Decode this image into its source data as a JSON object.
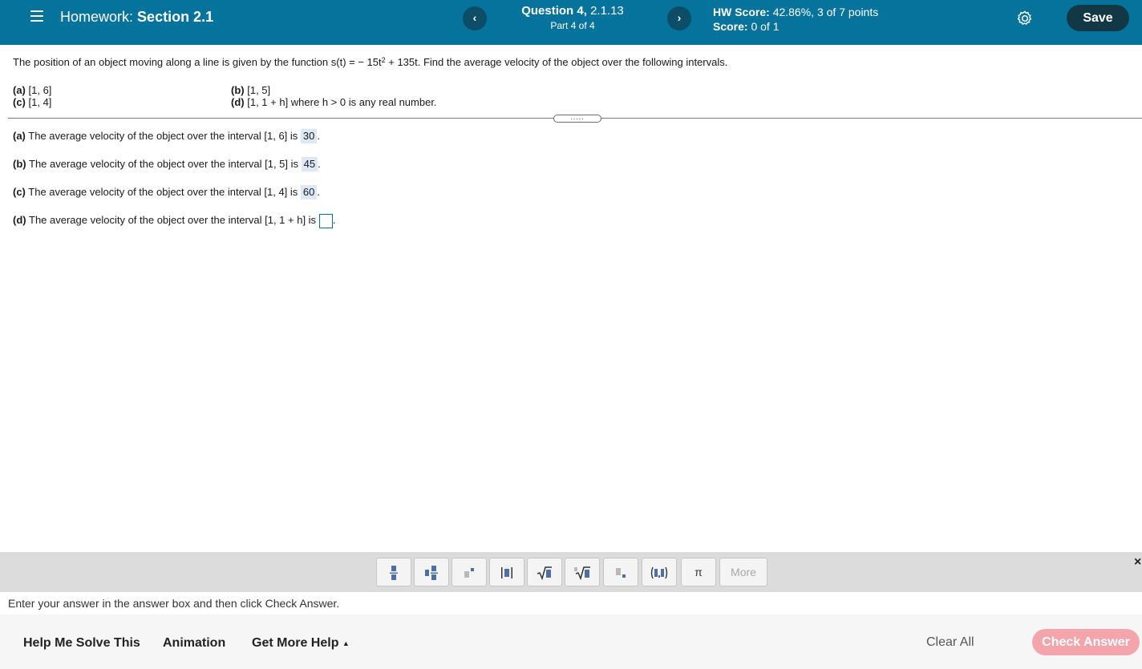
{
  "header": {
    "title_prefix": "Homework:",
    "title_name": "Section 2.1",
    "question_label": "Question 4,",
    "question_id": "2.1.13",
    "part_text": "Part 4 of 4",
    "hw_score_label": "HW Score:",
    "hw_score_value": "42.86%, 3 of 7 points",
    "score_label": "Score:",
    "score_value": "0 of 1",
    "prev_label": "‹",
    "next_label": "›",
    "save_label": "Save"
  },
  "question": {
    "text_before": "The position of an object moving along a line is given by the function s(t) = − 15t",
    "exponent": "2",
    "text_after": " + 135t. Find the average velocity of the object over the following intervals.",
    "intervals": [
      {
        "label": "(a)",
        "text": "[1, 6]"
      },
      {
        "label": "(b)",
        "text": "[1, 5]"
      },
      {
        "label": "(c)",
        "text": "[1, 4]"
      },
      {
        "label": "(d)",
        "text": "[1, 1 + h] where h > 0 is any real number."
      }
    ],
    "divider_handle": "....."
  },
  "answers": [
    {
      "label": "(a)",
      "text": "The average velocity of the object over the interval [1, 6] is",
      "value": "30"
    },
    {
      "label": "(b)",
      "text": "The average velocity of the object over the interval [1, 5] is",
      "value": "45"
    },
    {
      "label": "(c)",
      "text": "The average velocity of the object over the interval [1, 4] is",
      "value": "60"
    },
    {
      "label": "(d)",
      "text": "The average velocity of the object over the interval [1, 1 + h] is",
      "value": ""
    }
  ],
  "toolbar": {
    "pi_label": "π",
    "more_label": "More",
    "close_label": "×"
  },
  "instruction": "Enter your answer in the answer box and then click Check Answer.",
  "footer": {
    "help_label": "Help Me Solve This",
    "animation_label": "Animation",
    "more_help_label": "Get More Help",
    "caret": "▲",
    "clear_label": "Clear All",
    "check_label": "Check Answer"
  },
  "colors": {
    "header_bg": "#05739b",
    "save_bg": "#133845",
    "check_bg": "#f3a5ab",
    "answer_highlight": "#dde7f5"
  }
}
